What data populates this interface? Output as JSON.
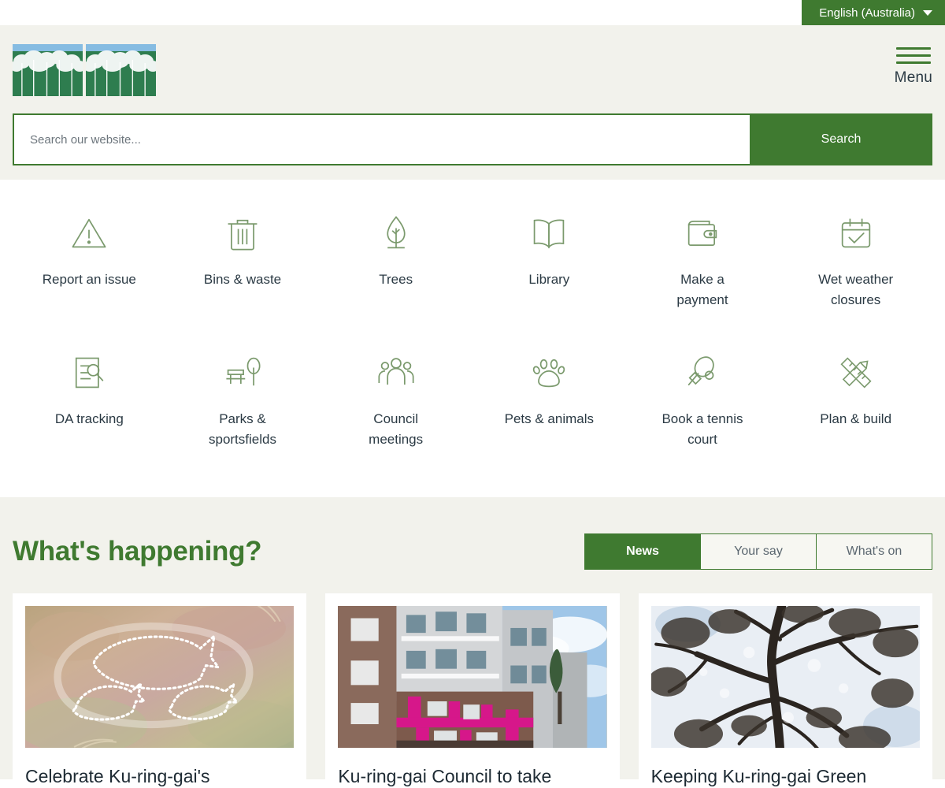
{
  "topbar": {
    "language_label": "English (Australia)",
    "caret_icon": "chevron-down-icon"
  },
  "header": {
    "logo_alt": "Ku-ring-gai Council logo",
    "menu_label": "Menu",
    "menu_icon": "hamburger-icon",
    "search": {
      "placeholder": "Search our website...",
      "value": "",
      "button_label": "Search"
    }
  },
  "quicklinks": [
    {
      "label": "Report an issue",
      "icon": "warning-triangle-icon"
    },
    {
      "label": "Bins & waste",
      "icon": "trash-bin-icon"
    },
    {
      "label": "Trees",
      "icon": "tree-icon"
    },
    {
      "label": "Library",
      "icon": "open-book-icon"
    },
    {
      "label": "Make a payment",
      "icon": "wallet-icon"
    },
    {
      "label": "Wet weather closures",
      "icon": "calendar-check-icon"
    },
    {
      "label": "DA tracking",
      "icon": "document-search-icon"
    },
    {
      "label": "Parks & sportsfields",
      "icon": "park-bench-tree-icon"
    },
    {
      "label": "Council meetings",
      "icon": "people-group-icon"
    },
    {
      "label": "Pets & animals",
      "icon": "paw-print-icon"
    },
    {
      "label": "Book a tennis court",
      "icon": "tennis-racquet-ball-icon"
    },
    {
      "label": "Plan & build",
      "icon": "ruler-pencil-icon"
    }
  ],
  "happening": {
    "title": "What's happening?",
    "tabs": [
      {
        "label": "News",
        "active": true
      },
      {
        "label": "Your say",
        "active": false
      },
      {
        "label": "What's on",
        "active": false
      }
    ],
    "cards": [
      {
        "title": "Celebrate Ku-ring-gai's",
        "image": "aboriginal-rock-engraving-fish-sandstone"
      },
      {
        "title": "Ku-ring-gai Council to take",
        "image": "apartment-buildings-street-magenta-facade"
      },
      {
        "title": "Keeping Ku-ring-gai Green",
        "image": "tree-canopy-branches-against-sky"
      }
    ]
  },
  "colors": {
    "brand_green": "#3F7A30",
    "logo_green": "#2E7D4F",
    "logo_sky": "#86BCE2",
    "header_bg": "#F2F2EC",
    "icon_green": "#7B9A6D",
    "text_dark": "#2B3A44"
  }
}
